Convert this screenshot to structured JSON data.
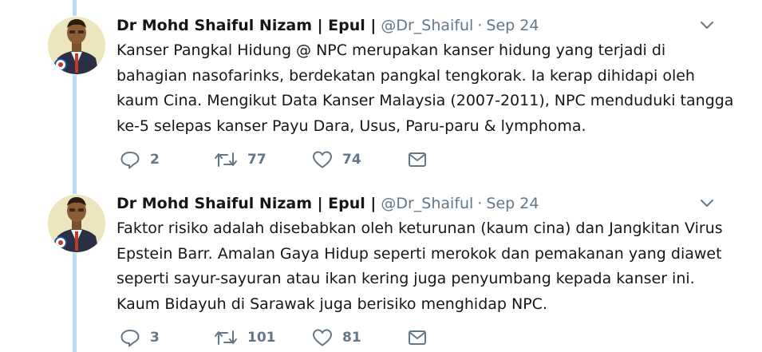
{
  "colors": {
    "thread_line": "#b8dcf5",
    "text": "#14171a",
    "secondary": "#657786"
  },
  "tweets": [
    {
      "author_name": "Dr Mohd Shaiful Nizam | Epul |",
      "handle": "@Dr_Shaiful",
      "separator": "·",
      "date": "Sep 24",
      "lines": [
        "Kanser Pangkal Hidung @ NPC merupakan kanser hidung yang terjadi di",
        "bahagian nasofarinks, berdekatan pangkal tengkorak. Ia kerap dihidapi oleh",
        "kaum Cina. Mengikut Data Kanser Malaysia (2007-2011), NPC menduduki tangga",
        "ke-5 selepas kanser Payu Dara, Usus, Paru-paru & lymphoma."
      ],
      "replies": "2",
      "retweets": "77",
      "likes": "74",
      "icons": [
        "reply-icon",
        "retweet-icon",
        "like-icon",
        "direct-message-icon",
        "chevron-down-icon"
      ]
    },
    {
      "author_name": "Dr Mohd Shaiful Nizam | Epul |",
      "handle": "@Dr_Shaiful",
      "separator": "·",
      "date": "Sep 24",
      "lines": [
        "Faktor risiko adalah disebabkan oleh keturunan (kaum cina) dan Jangkitan Virus",
        "Epstein Barr. Amalan Gaya Hidup seperti merokok dan pemakanan yang diawet",
        "seperti sayur-sayuran atau ikan kering juga penyumbang kepada kanser ini.",
        "Kaum Bidayuh di Sarawak juga berisiko menghidap NPC."
      ],
      "replies": "3",
      "retweets": "101",
      "likes": "81",
      "icons": [
        "reply-icon",
        "retweet-icon",
        "like-icon",
        "direct-message-icon",
        "chevron-down-icon"
      ]
    }
  ]
}
